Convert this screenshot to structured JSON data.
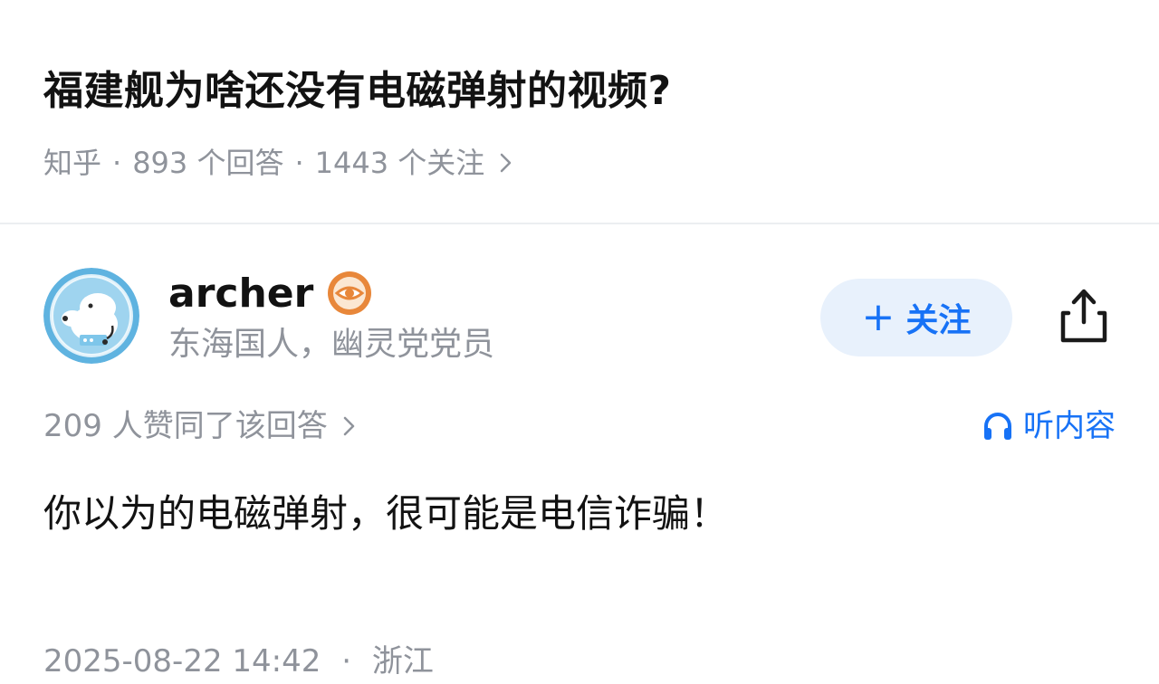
{
  "question": {
    "title": "福建舰为啥还没有电磁弹射的视频?",
    "source": "知乎",
    "separator": "·",
    "answers": "893 个回答",
    "followers": "1443 个关注"
  },
  "author": {
    "name": "archer",
    "bio": "东海国人，幽灵党党员",
    "badge_icon": "eye-badge-icon",
    "follow_plus": "+",
    "follow_label": "关注"
  },
  "stats": {
    "votes": "209 人赞同了该回答",
    "listen": "听内容"
  },
  "answer": {
    "text": "你以为的电磁弹射，很可能是电信诈骗！"
  },
  "footer": {
    "date": "2025-08-22 14:42",
    "separator": "·",
    "location": "浙江"
  },
  "colors": {
    "accent": "#1772f6",
    "follow_bg": "#e8f1fc",
    "meta": "#8f939b",
    "badge": "#e8873a"
  }
}
